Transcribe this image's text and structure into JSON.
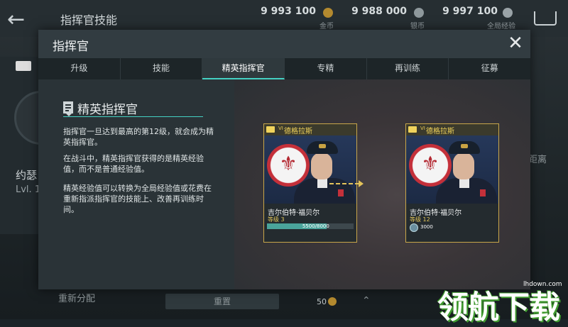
{
  "background": {
    "title": "指挥官技能",
    "currencies": [
      {
        "amount": "9 993 100",
        "label": "金币"
      },
      {
        "amount": "9 988 000",
        "label": "银币"
      },
      {
        "amount": "9 997 100",
        "label": "全局经验"
      }
    ],
    "commander_name": "约瑟",
    "commander_level": "Lvl. 1",
    "right_hint": "距离",
    "bottom_label": "重新分配",
    "reset_label": "重置",
    "cost": "50"
  },
  "modal": {
    "title": "指挥官",
    "tabs": [
      {
        "label": "升级"
      },
      {
        "label": "技能"
      },
      {
        "label": "精英指挥官",
        "active": true
      },
      {
        "label": "专精"
      },
      {
        "label": "再训练"
      },
      {
        "label": "征募"
      }
    ],
    "section_title": "精英指挥官",
    "paragraphs": [
      "指挥官一旦达到最高的第12级，就会成为精英指挥官。",
      "在战斗中，精英指挥官获得的是精英经验值，而不是普通经验值。",
      "精英经验值可以转换为全局经验值或花费在重新指派指挥官的技能上、改善再训练时间。"
    ],
    "cards": [
      {
        "tier": "VI",
        "nation": "德格拉斯",
        "name": "吉尔伯特·福贝尔",
        "level": "等级 3",
        "xp_text": "5500/8000",
        "xp_fraction": 0.69
      },
      {
        "tier": "VI",
        "nation": "德格拉斯",
        "name": "吉尔伯特·福贝尔",
        "level": "等级 12",
        "elite_xp": "3000"
      }
    ]
  },
  "watermark": {
    "text": "领航下载",
    "url": "lhdown.com"
  },
  "colors": {
    "accent": "#44d1c3",
    "gold": "#c8a64a",
    "modal_bg": "#2b3438"
  }
}
